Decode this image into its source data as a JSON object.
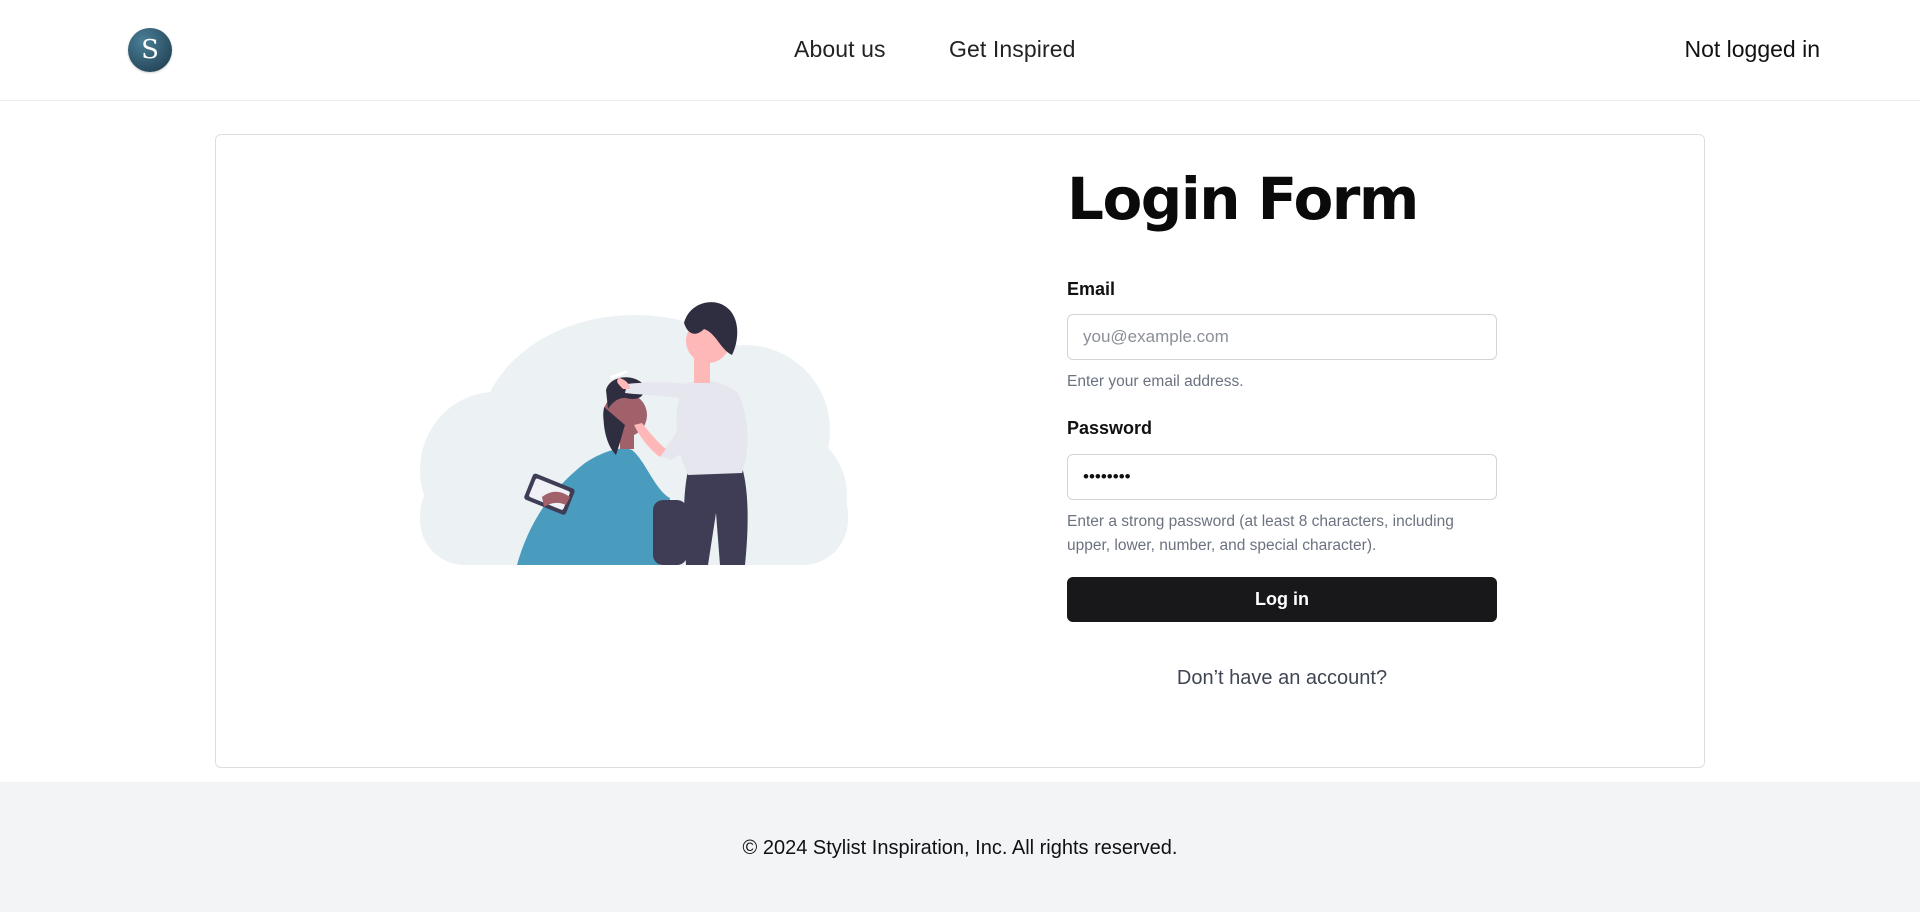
{
  "header": {
    "logo_letter": "S",
    "nav": [
      {
        "label": "About us"
      },
      {
        "label": "Get Inspired"
      }
    ],
    "user_status": "Not logged in"
  },
  "form": {
    "title": "Login Form",
    "email": {
      "label": "Email",
      "placeholder": "you@example.com",
      "value": "",
      "hint": "Enter your email address."
    },
    "password": {
      "label": "Password",
      "value": "••••••••",
      "hint": "Enter a strong password (at least 8 characters, including upper, lower, number, and special character)."
    },
    "submit_label": "Log in",
    "signup_link": "Don’t have an account?"
  },
  "footer": {
    "copyright": "© 2024 Stylist Inspiration, Inc. All rights reserved."
  },
  "colors": {
    "button_bg": "#18181b",
    "footer_bg": "#f3f4f6",
    "cape": "#4a9cbf",
    "cloud": "#ecf1f4"
  }
}
